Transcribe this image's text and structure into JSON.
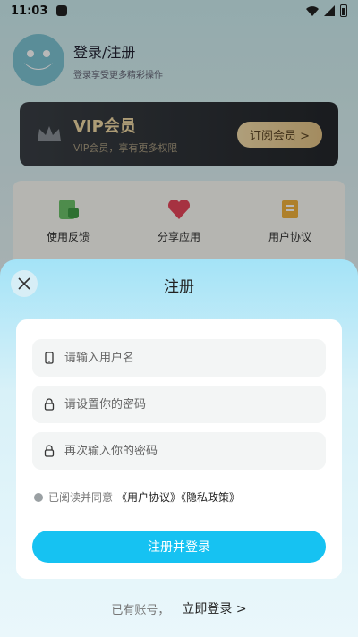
{
  "status": {
    "time": "11:03"
  },
  "profile": {
    "title": "登录/注册",
    "subtitle": "登录享受更多精彩操作"
  },
  "vip": {
    "title": "VIP会员",
    "subtitle": "VIP会员，享有更多权限",
    "button": "订阅会员 >"
  },
  "menu": {
    "items": [
      {
        "label": "使用反馈",
        "icon": "feedback-icon"
      },
      {
        "label": "分享应用",
        "icon": "heart-icon"
      },
      {
        "label": "用户协议",
        "icon": "document-icon"
      }
    ]
  },
  "sheet": {
    "title": "注册",
    "username_placeholder": "请输入用户名",
    "password_placeholder": "请设置你的密码",
    "confirm_placeholder": "再次输入你的密码",
    "agree_text": "已阅读并同意",
    "agree_link": "《用户协议》《隐私政策》",
    "submit": "注册并登录",
    "bottom_hint": "已有账号，",
    "bottom_link": "立即登录 >"
  },
  "colors": {
    "accent": "#16c2f2",
    "vip_gold": "#f0d9a4"
  }
}
